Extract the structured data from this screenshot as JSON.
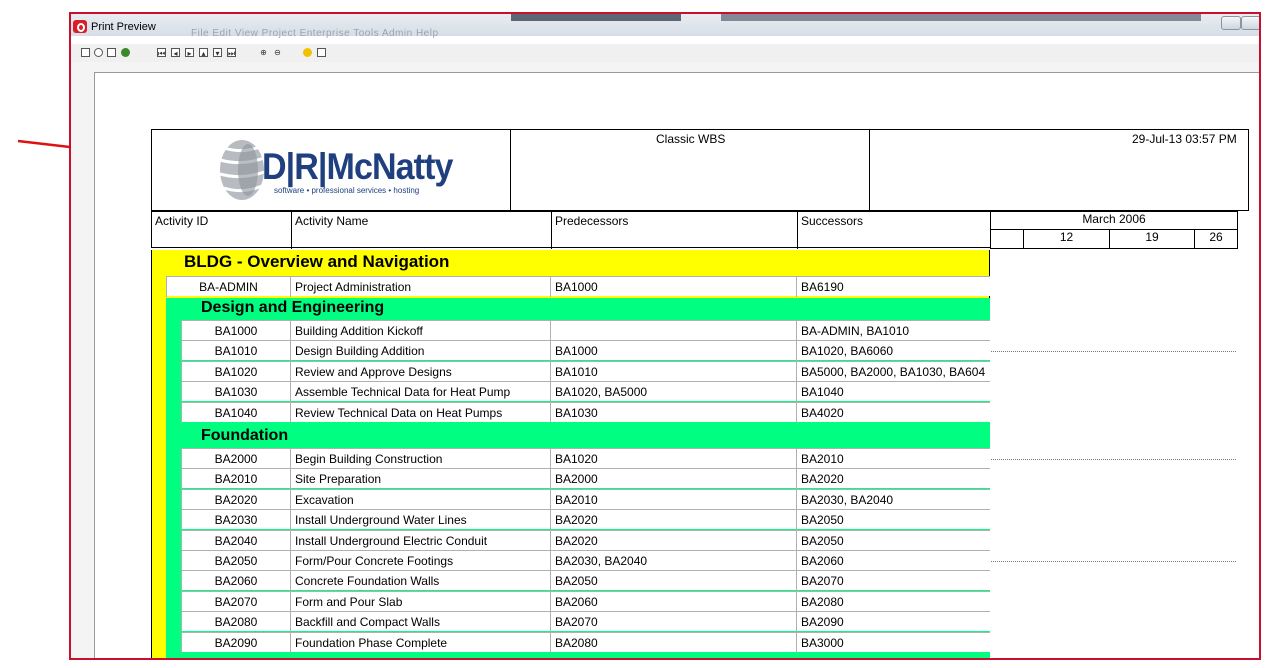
{
  "window": {
    "title": "Print Preview",
    "ghost_menu": "File   Edit   View   Project   Enterprise   Tools   Admin   Help"
  },
  "toolbar": {
    "icons": [
      "page-setup-icon",
      "options-icon",
      "print-icon",
      "color-icon",
      "first-page-icon",
      "previous-page-icon",
      "next-page-icon",
      "last-page-icon",
      "page-down-icon",
      "page-end-icon",
      "zoom-in-icon",
      "zoom-out-icon",
      "help-icon",
      "close-preview-icon"
    ]
  },
  "report": {
    "title": "Classic WBS",
    "datetime": "29-Jul-13 03:57 PM",
    "logo_main": "D|R|McNatty",
    "logo_sub": "software • professional services • hosting",
    "columns": {
      "activity_id": "Activity ID",
      "activity_name": "Activity Name",
      "predecessors": "Predecessors",
      "successors": "Successors"
    },
    "timescale": {
      "month": "March 2006",
      "weeks": [
        "",
        "12",
        "19",
        "26"
      ]
    }
  },
  "groups": {
    "top": "BLDG - Overview and Navigation",
    "design": "Design and Engineering",
    "foundation": "Foundation"
  },
  "rows": {
    "admin": {
      "id": "BA-ADMIN",
      "name": "Project Administration",
      "pred": "BA1000",
      "succ": "BA6190"
    },
    "design": [
      {
        "id": "BA1000",
        "name": "Building Addition Kickoff",
        "pred": "",
        "succ": "BA-ADMIN, BA1010"
      },
      {
        "id": "BA1010",
        "name": "Design Building Addition",
        "pred": "BA1000",
        "succ": "BA1020, BA6060"
      },
      {
        "id": "BA1020",
        "name": "Review and Approve Designs",
        "pred": "BA1010",
        "succ": "BA5000, BA2000, BA1030, BA604"
      },
      {
        "id": "BA1030",
        "name": "Assemble Technical Data for Heat Pump",
        "pred": "BA1020, BA5000",
        "succ": "BA1040"
      },
      {
        "id": "BA1040",
        "name": "Review Technical Data on Heat Pumps",
        "pred": "BA1030",
        "succ": "BA4020"
      }
    ],
    "foundation": [
      {
        "id": "BA2000",
        "name": "Begin Building Construction",
        "pred": "BA1020",
        "succ": "BA2010"
      },
      {
        "id": "BA2010",
        "name": "Site Preparation",
        "pred": "BA2000",
        "succ": "BA2020"
      },
      {
        "id": "BA2020",
        "name": "Excavation",
        "pred": "BA2010",
        "succ": "BA2030, BA2040"
      },
      {
        "id": "BA2030",
        "name": "Install Underground Water Lines",
        "pred": "BA2020",
        "succ": "BA2050"
      },
      {
        "id": "BA2040",
        "name": "Install Underground Electric Conduit",
        "pred": "BA2020",
        "succ": "BA2050"
      },
      {
        "id": "BA2050",
        "name": "Form/Pour Concrete Footings",
        "pred": "BA2030, BA2040",
        "succ": "BA2060"
      },
      {
        "id": "BA2060",
        "name": "Concrete Foundation Walls",
        "pred": "BA2050",
        "succ": "BA2070"
      },
      {
        "id": "BA2070",
        "name": "Form and Pour Slab",
        "pred": "BA2060",
        "succ": "BA2080"
      },
      {
        "id": "BA2080",
        "name": "Backfill and Compact Walls",
        "pred": "BA2070",
        "succ": "BA2090"
      },
      {
        "id": "BA2090",
        "name": "Foundation Phase Complete",
        "pred": "BA2080",
        "succ": "BA3000"
      }
    ]
  },
  "colors": {
    "frame": "#c8102e",
    "level1": "#ffff00",
    "level2": "#00ff80",
    "logo": "#1f3f7f",
    "arrow": "#e01010"
  }
}
